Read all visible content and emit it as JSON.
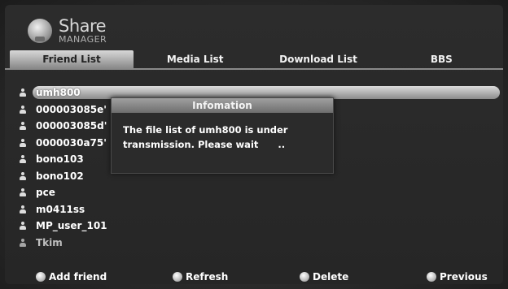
{
  "app": {
    "logo_share": "Share",
    "logo_manager": "MANAGER"
  },
  "tabs": [
    {
      "label": "Friend List",
      "active": true
    },
    {
      "label": "Media List",
      "active": false
    },
    {
      "label": "Download List",
      "active": false
    },
    {
      "label": "BBS",
      "active": false
    }
  ],
  "friends": [
    "umh800",
    "000003085e'",
    "000003085d'",
    "0000030a75'",
    "bono103",
    "bono102",
    "pce",
    "m0411ss",
    "MP_user_101",
    "Tkim"
  ],
  "selected_friend": "umh800",
  "dialog": {
    "title": "Infomation",
    "message": "The file list of umh800 is under\ntransmission. Please wait      .."
  },
  "footer": {
    "add_friend": "Add friend",
    "refresh": "Refresh",
    "delete": "Delete",
    "previous": "Previous"
  }
}
